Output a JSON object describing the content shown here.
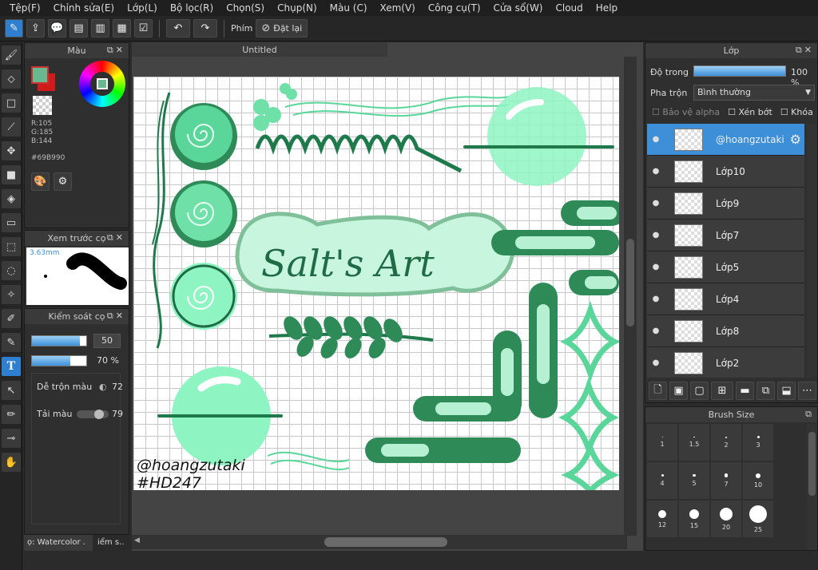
{
  "menu": [
    "Tệp(F)",
    "Chỉnh sửa(E)",
    "Lớp(L)",
    "Bộ lọc(R)",
    "Chọn(S)",
    "Chụp(N)",
    "Màu (C)",
    "Xem(V)",
    "Công cụ(T)",
    "Cửa sổ(W)",
    "Cloud",
    "Help"
  ],
  "toolbar": {
    "key_label": "Phím",
    "reset_label": "Đặt lại"
  },
  "color_panel": {
    "title": "Màu",
    "r": "R:105",
    "g": "G:185",
    "b": "B:144",
    "hex": "#69B990",
    "fg_color": "#69B990",
    "bg_color": "#d11a1a"
  },
  "preview_panel": {
    "title": "Xem trước cọ",
    "size": "3.63mm"
  },
  "brush_control": {
    "title": "Kiểm soát cọ",
    "size_value": "50",
    "opacity_value": "70 %",
    "size_fraction": 0.88,
    "opacity_fraction": 0.7,
    "blend_label": "Dễ trộn màu",
    "blend_value": "72",
    "paint_label": "Tải màu",
    "paint_value": "79",
    "tab1": "ọ: Watercolor .",
    "tab2": "iểm s.."
  },
  "document": {
    "tab_title": "Untitled",
    "watermark_name": "@hoangzutaki",
    "watermark_tag": "#HD247",
    "art_title": "Salt's Art"
  },
  "layer_panel": {
    "title": "Lớp",
    "opacity_label": "Độ trong",
    "opacity_value": "100 %",
    "opacity_fraction": 1.0,
    "blend_label": "Pha trộn",
    "blend_value": "Bình thường",
    "protect_alpha": "Bảo vệ alpha",
    "clipping": "Xén bớt",
    "lock": "Khóa",
    "layers": [
      {
        "name": "@hoangzutaki",
        "selected": true
      },
      {
        "name": "Lớp10"
      },
      {
        "name": "Lớp9"
      },
      {
        "name": "Lớp7"
      },
      {
        "name": "Lớp5"
      },
      {
        "name": "Lớp4"
      },
      {
        "name": "Lớp8"
      },
      {
        "name": "Lớp2"
      }
    ]
  },
  "brush_size_panel": {
    "title": "Brush Size",
    "sizes": [
      "1",
      "1.5",
      "2",
      "3",
      "4",
      "5",
      "7",
      "10",
      "12",
      "15",
      "20",
      "25"
    ]
  }
}
